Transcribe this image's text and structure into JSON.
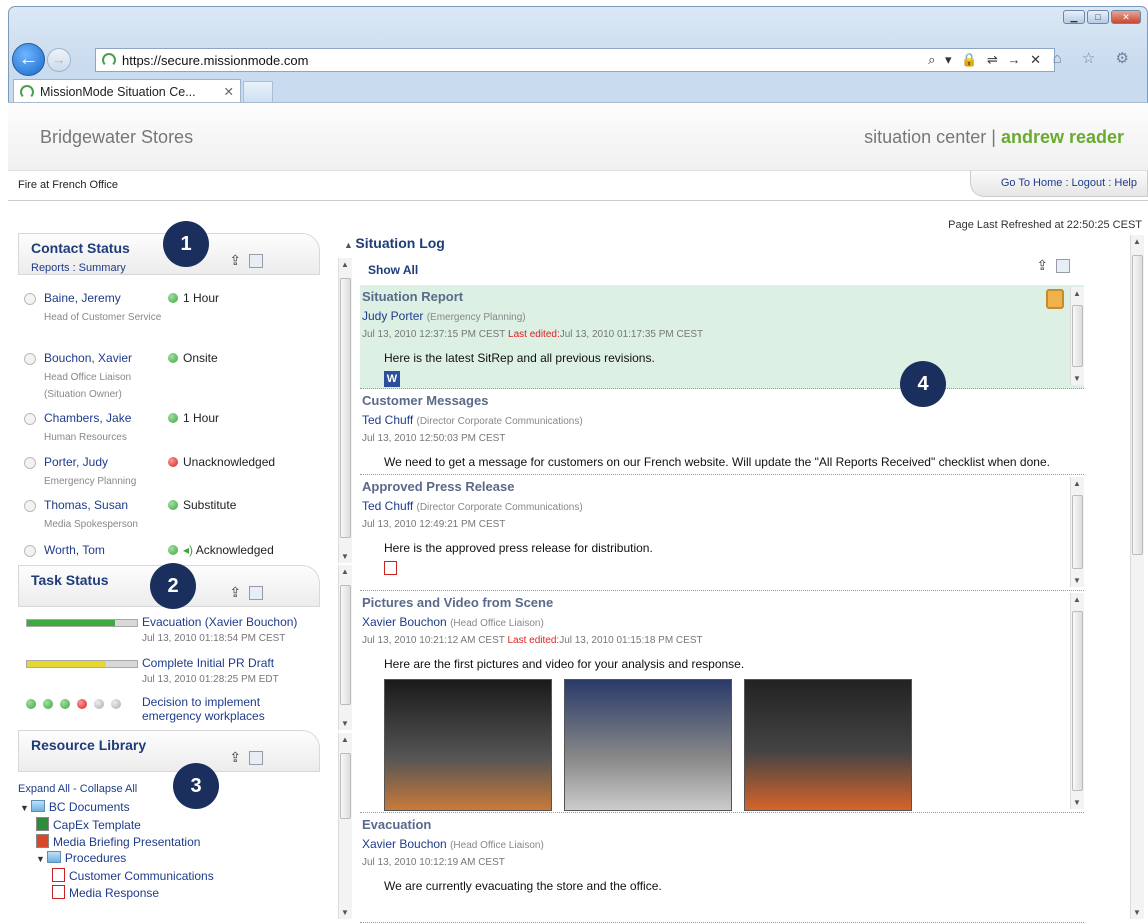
{
  "browser": {
    "url": "https://secure.missionmode.com",
    "tab_title": "MissionMode Situation Ce...",
    "tab_close": "✕",
    "addr_tools": "⌕ ▾ 🔒 ⇌ → ✕",
    "nav_icons": "⌂ ☆ ⚙"
  },
  "header": {
    "company": "Bridgewater Stores",
    "section": "situation center",
    "separator": "|",
    "user": "andrew reader",
    "incident": "Fire at French Office",
    "links": "Go To Home : Logout : Help",
    "refreshed": "Page Last Refreshed at 22:50:25 CEST"
  },
  "badges": [
    "1",
    "2",
    "3",
    "4"
  ],
  "contact_status": {
    "title": "Contact Status",
    "subtitle": "Reports : Summary",
    "contacts": [
      {
        "name": "Baine, Jeremy",
        "role": "Head of Customer Service",
        "status": "1 Hour",
        "color": "green"
      },
      {
        "name": "Bouchon, Xavier",
        "role": "Head Office Liaison (Situation Owner)",
        "status": "Onsite",
        "color": "green"
      },
      {
        "name": "Chambers, Jake",
        "role": "Human Resources",
        "status": "1 Hour",
        "color": "green"
      },
      {
        "name": "Porter, Judy",
        "role": "Emergency Planning",
        "status": "Unacknowledged",
        "color": "red"
      },
      {
        "name": "Thomas, Susan",
        "role": "Media Spokesperson",
        "status": "Substitute",
        "color": "green"
      },
      {
        "name": "Worth, Tom",
        "role": "",
        "status": "Acknowledged",
        "color": "green"
      }
    ]
  },
  "task_status": {
    "title": "Task Status",
    "tasks": [
      {
        "title": "Evacuation (Xavier Bouchon)",
        "date": "Jul 13, 2010 01:18:54 PM CEST",
        "progress": 0.8,
        "color": "#3faa3f"
      },
      {
        "title": "Complete Initial PR Draft",
        "date": "Jul 13, 2010 01:28:25 PM EDT",
        "progress": 0.72,
        "color": "#e6d830"
      },
      {
        "title": "Decision to implement emergency workplaces",
        "date": "",
        "progress": null,
        "color": ""
      }
    ],
    "task3_dots": [
      "green",
      "green",
      "green",
      "red",
      "grey",
      "grey"
    ]
  },
  "resource_library": {
    "title": "Resource Library",
    "expand_collapse": "Expand All - Collapse All",
    "items": [
      {
        "label": "BC Documents",
        "type": "folder",
        "level": 0
      },
      {
        "label": "CapEx Template",
        "type": "xls",
        "level": 1
      },
      {
        "label": "Media Briefing Presentation",
        "type": "ppt",
        "level": 1
      },
      {
        "label": "Procedures",
        "type": "folder",
        "level": 1
      },
      {
        "label": "Customer Communications",
        "type": "pdf",
        "level": 2
      },
      {
        "label": "Media Response",
        "type": "pdf",
        "level": 2
      }
    ]
  },
  "situation_log": {
    "title": "Situation Log",
    "show_all": "Show All",
    "entries": [
      {
        "title": "Situation Report",
        "author": "Judy Porter",
        "role": "(Emergency Planning)",
        "date": "Jul 13, 2010 12:37:15 PM CEST",
        "edited_label": "Last edited:",
        "edited": "Jul 13, 2010 01:17:35 PM CEST",
        "body": "Here is the latest SitRep and all previous revisions.",
        "attachment": "W"
      },
      {
        "title": "Customer Messages",
        "author": "Ted Chuff",
        "role": "(Director Corporate Communications)",
        "date": "Jul 13, 2010 12:50:03 PM CEST",
        "body": "We need to get a message for customers on our French website. Will update the \"All Reports Received\" checklist when done."
      },
      {
        "title": "Approved Press Release",
        "author": "Ted Chuff",
        "role": "(Director Corporate Communications)",
        "date": "Jul 13, 2010 12:49:21 PM CEST",
        "body": "Here is the approved press release for distribution."
      },
      {
        "title": "Pictures and Video from Scene",
        "author": "Xavier Bouchon",
        "role": "(Head Office Liaison)",
        "date": "Jul 13, 2010 10:21:12 AM CEST",
        "edited_label": "Last edited:",
        "edited": "Jul 13, 2010 01:15:18 PM CEST",
        "body": "Here are the first pictures and video for your analysis and response."
      },
      {
        "title": "Evacuation",
        "author": "Xavier Bouchon",
        "role": "(Head Office Liaison)",
        "date": "Jul 13, 2010 10:12:19 AM CEST",
        "body": "We are currently evacuating the store and the office."
      }
    ]
  }
}
